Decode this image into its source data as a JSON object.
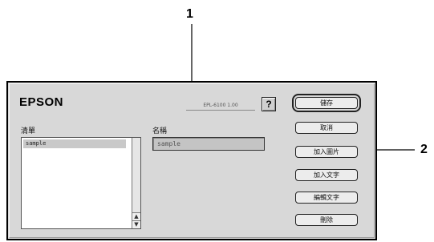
{
  "callouts": [
    {
      "number": "1",
      "target": "name-field"
    },
    {
      "number": "2",
      "target": "add-image-button"
    }
  ],
  "dialog": {
    "brand": "EPSON",
    "version_label": "EPL-6100 1.00",
    "help_label": "?",
    "list_label": "清單",
    "list_items": [
      "sample"
    ],
    "scroll_up": "▲",
    "scroll_down": "▼",
    "name_label": "名稱",
    "name_value": "sample",
    "buttons": {
      "save": "儲存",
      "cancel": "取消",
      "add_image": "加入圖片",
      "add_text": "加入文字",
      "edit_text": "編輯文字",
      "delete": "刪除"
    }
  }
}
